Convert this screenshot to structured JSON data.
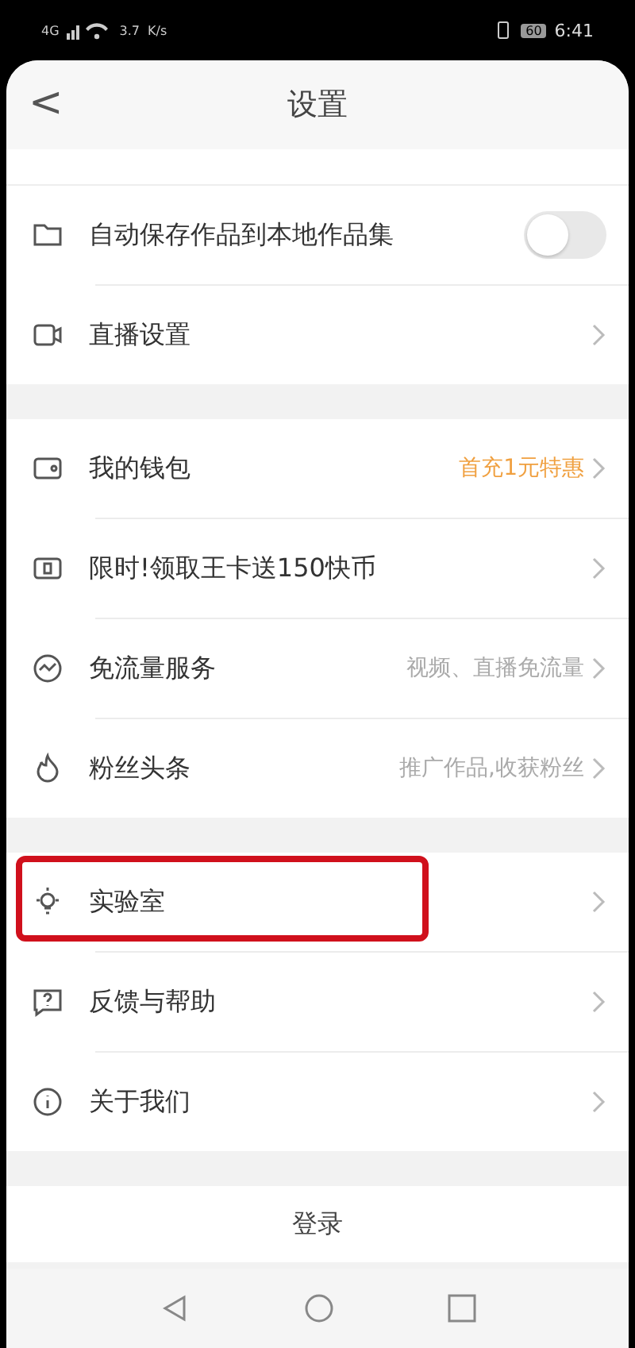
{
  "status_bar": {
    "network": "4G",
    "speed": "3.7",
    "speed_unit": "K/s",
    "battery": "60",
    "time": "6:41"
  },
  "header": {
    "back": "<",
    "title": "设置"
  },
  "groups": [
    {
      "items": [
        {
          "kind": "toggle",
          "label": "自动保存作品到本地作品集",
          "on": false,
          "highlighted": false
        },
        {
          "kind": "link",
          "label": "直播设置",
          "highlighted": false
        }
      ]
    },
    {
      "items": [
        {
          "kind": "link",
          "label": "我的钱包",
          "value": "首充1元特惠",
          "promo": true,
          "highlighted": false
        },
        {
          "kind": "link",
          "label": "限时!领取王卡送150快币",
          "highlighted": false
        },
        {
          "kind": "link",
          "label": "免流量服务",
          "value": "视频、直播免流量",
          "promo": false,
          "highlighted": false
        },
        {
          "kind": "link",
          "label": "粉丝头条",
          "value": "推广作品,收获粉丝",
          "promo": false,
          "highlighted": false
        }
      ]
    },
    {
      "items": [
        {
          "kind": "link",
          "label": "实验室",
          "highlighted": true
        },
        {
          "kind": "link",
          "label": "反馈与帮助",
          "highlighted": false
        },
        {
          "kind": "link",
          "label": "关于我们",
          "highlighted": false
        }
      ]
    }
  ],
  "login": "登录"
}
